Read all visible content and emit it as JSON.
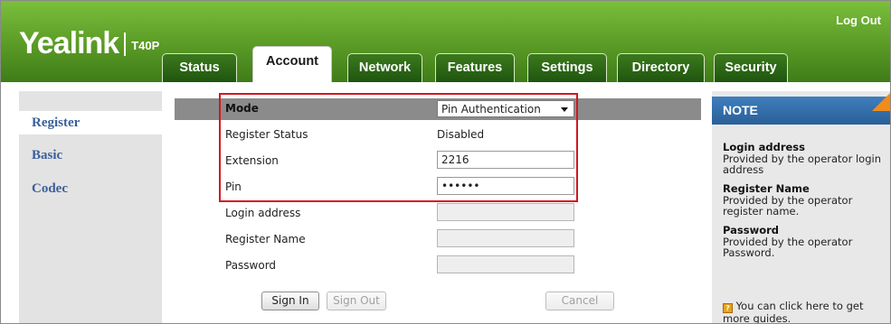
{
  "header": {
    "brand": "Yealink",
    "model": "T40P",
    "logout_label": "Log Out"
  },
  "tabs": [
    {
      "label": "Status",
      "active": false
    },
    {
      "label": "Account",
      "active": true
    },
    {
      "label": "Network",
      "active": false
    },
    {
      "label": "Features",
      "active": false
    },
    {
      "label": "Settings",
      "active": false
    },
    {
      "label": "Directory",
      "active": false
    },
    {
      "label": "Security",
      "active": false
    }
  ],
  "sidebar": {
    "items": [
      {
        "label": "Register",
        "active": true
      },
      {
        "label": "Basic",
        "active": false
      },
      {
        "label": "Codec",
        "active": false
      }
    ]
  },
  "form": {
    "mode": {
      "label": "Mode",
      "value": "Pin Authentication"
    },
    "register_status": {
      "label": "Register Status",
      "value": "Disabled"
    },
    "extension": {
      "label": "Extension",
      "value": "2216"
    },
    "pin": {
      "label": "Pin",
      "value": "••••••"
    },
    "login_address": {
      "label": "Login address",
      "value": ""
    },
    "register_name": {
      "label": "Register Name",
      "value": ""
    },
    "password": {
      "label": "Password",
      "value": ""
    }
  },
  "buttons": {
    "sign_in": "Sign In",
    "sign_out": "Sign Out",
    "cancel": "Cancel"
  },
  "note": {
    "title": "NOTE",
    "entries": [
      {
        "title": "Login address",
        "text": "Provided by the operator login address"
      },
      {
        "title": "Register Name",
        "text": "Provided by the operator register name."
      },
      {
        "title": "Password",
        "text": "Provided by the operator Password."
      }
    ],
    "guide_text": "You can click here to get more guides.",
    "guide_icon_glyph": "?"
  },
  "colors": {
    "header_green": "#5a9a26",
    "tab_dark_green": "#2b6a16",
    "highlight_red": "#d4161e",
    "note_blue": "#2f6aa6",
    "note_corner_orange": "#f08c1a",
    "sidebar_link_blue": "#3a5f9c"
  }
}
